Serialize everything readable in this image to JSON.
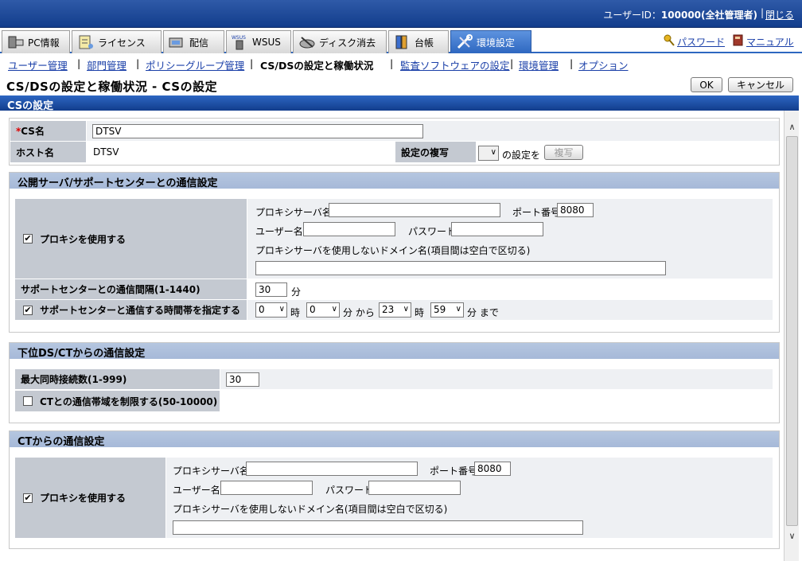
{
  "header": {
    "user_label": "ユーザーID：",
    "user_value": "100000(全社管理者)",
    "separator": "|",
    "close": "閉じる"
  },
  "tabs": [
    {
      "label": "PC情報",
      "icon": "pc-icon"
    },
    {
      "label": "ライセンス",
      "icon": "license-icon"
    },
    {
      "label": "配信",
      "icon": "delivery-icon"
    },
    {
      "label": "WSUS",
      "icon": "wsus-icon"
    },
    {
      "label": "ディスク消去",
      "icon": "disk-erase-icon"
    },
    {
      "label": "台帳",
      "icon": "ledger-icon"
    },
    {
      "label": "環境設定",
      "icon": "settings-icon"
    }
  ],
  "right_links": {
    "password": "パスワード",
    "manual": "マニュアル"
  },
  "subnav": {
    "user_mgmt": "ユーザー管理",
    "dept_mgmt": "部門管理",
    "policy_group_mgmt": "ポリシーグループ管理",
    "cs_ds_status": "CS/DSの設定と稼働状況",
    "monitor_software": "監査ソフトウェアの設定",
    "env_mgmt": "環境管理",
    "options": "オプション",
    "bar": "|"
  },
  "page": {
    "title": "CS/DSの設定と稼働状況 - CSの設定",
    "ok": "OK",
    "cancel": "キャンセル",
    "section_title": "CSの設定"
  },
  "basic": {
    "cs_name_required_mark": "*",
    "cs_name_label": "CS名",
    "cs_name_value": "DTSV",
    "host_label": "ホスト名",
    "host_value": "DTSV",
    "copy_label": "設定の複写",
    "copy_suffix": "の設定を",
    "copy_button": "複写"
  },
  "public_server": {
    "title": "公開サーバ/サポートセンターとの通信設定",
    "use_proxy_label": "プロキシを使用する",
    "use_proxy_checked": true,
    "proxy_server_label": "プロキシサーバ名",
    "proxy_server_value": "",
    "port_label": "ポート番号",
    "port_value": "8080",
    "user_label": "ユーザー名",
    "user_value": "",
    "password_label": "パスワード",
    "password_value": "",
    "no_proxy_label": "プロキシサーバを使用しないドメイン名(項目間は空白で区切る)",
    "no_proxy_value": "",
    "interval_label": "サポートセンターとの通信間隔(1-1440)",
    "interval_value": "30",
    "interval_unit": "分",
    "timeband_label": "サポートセンターと通信する時間帯を指定する",
    "timeband_checked": true,
    "from_hour": "0",
    "from_min": "0",
    "to_hour": "23",
    "to_min": "59",
    "unit_hour": "時",
    "unit_min_from": "分 から",
    "unit_min_to": "分 まで"
  },
  "lower_ds": {
    "title": "下位DS/CTからの通信設定",
    "max_conn_label": "最大同時接続数(1-999)",
    "max_conn_value": "30",
    "limit_bw_label": "CTとの通信帯域を制限する(50-10000)",
    "limit_bw_checked": false
  },
  "ct_comm": {
    "title": "CTからの通信設定",
    "use_proxy_label": "プロキシを使用する",
    "use_proxy_checked": true,
    "proxy_server_label": "プロキシサーバ名",
    "proxy_server_value": "",
    "port_label": "ポート番号",
    "port_value": "8080",
    "user_label": "ユーザー名",
    "user_value": "",
    "password_label": "パスワード",
    "password_value": "",
    "no_proxy_label": "プロキシサーバを使用しないドメイン名(項目間は空白で区切る)",
    "no_proxy_value": ""
  }
}
